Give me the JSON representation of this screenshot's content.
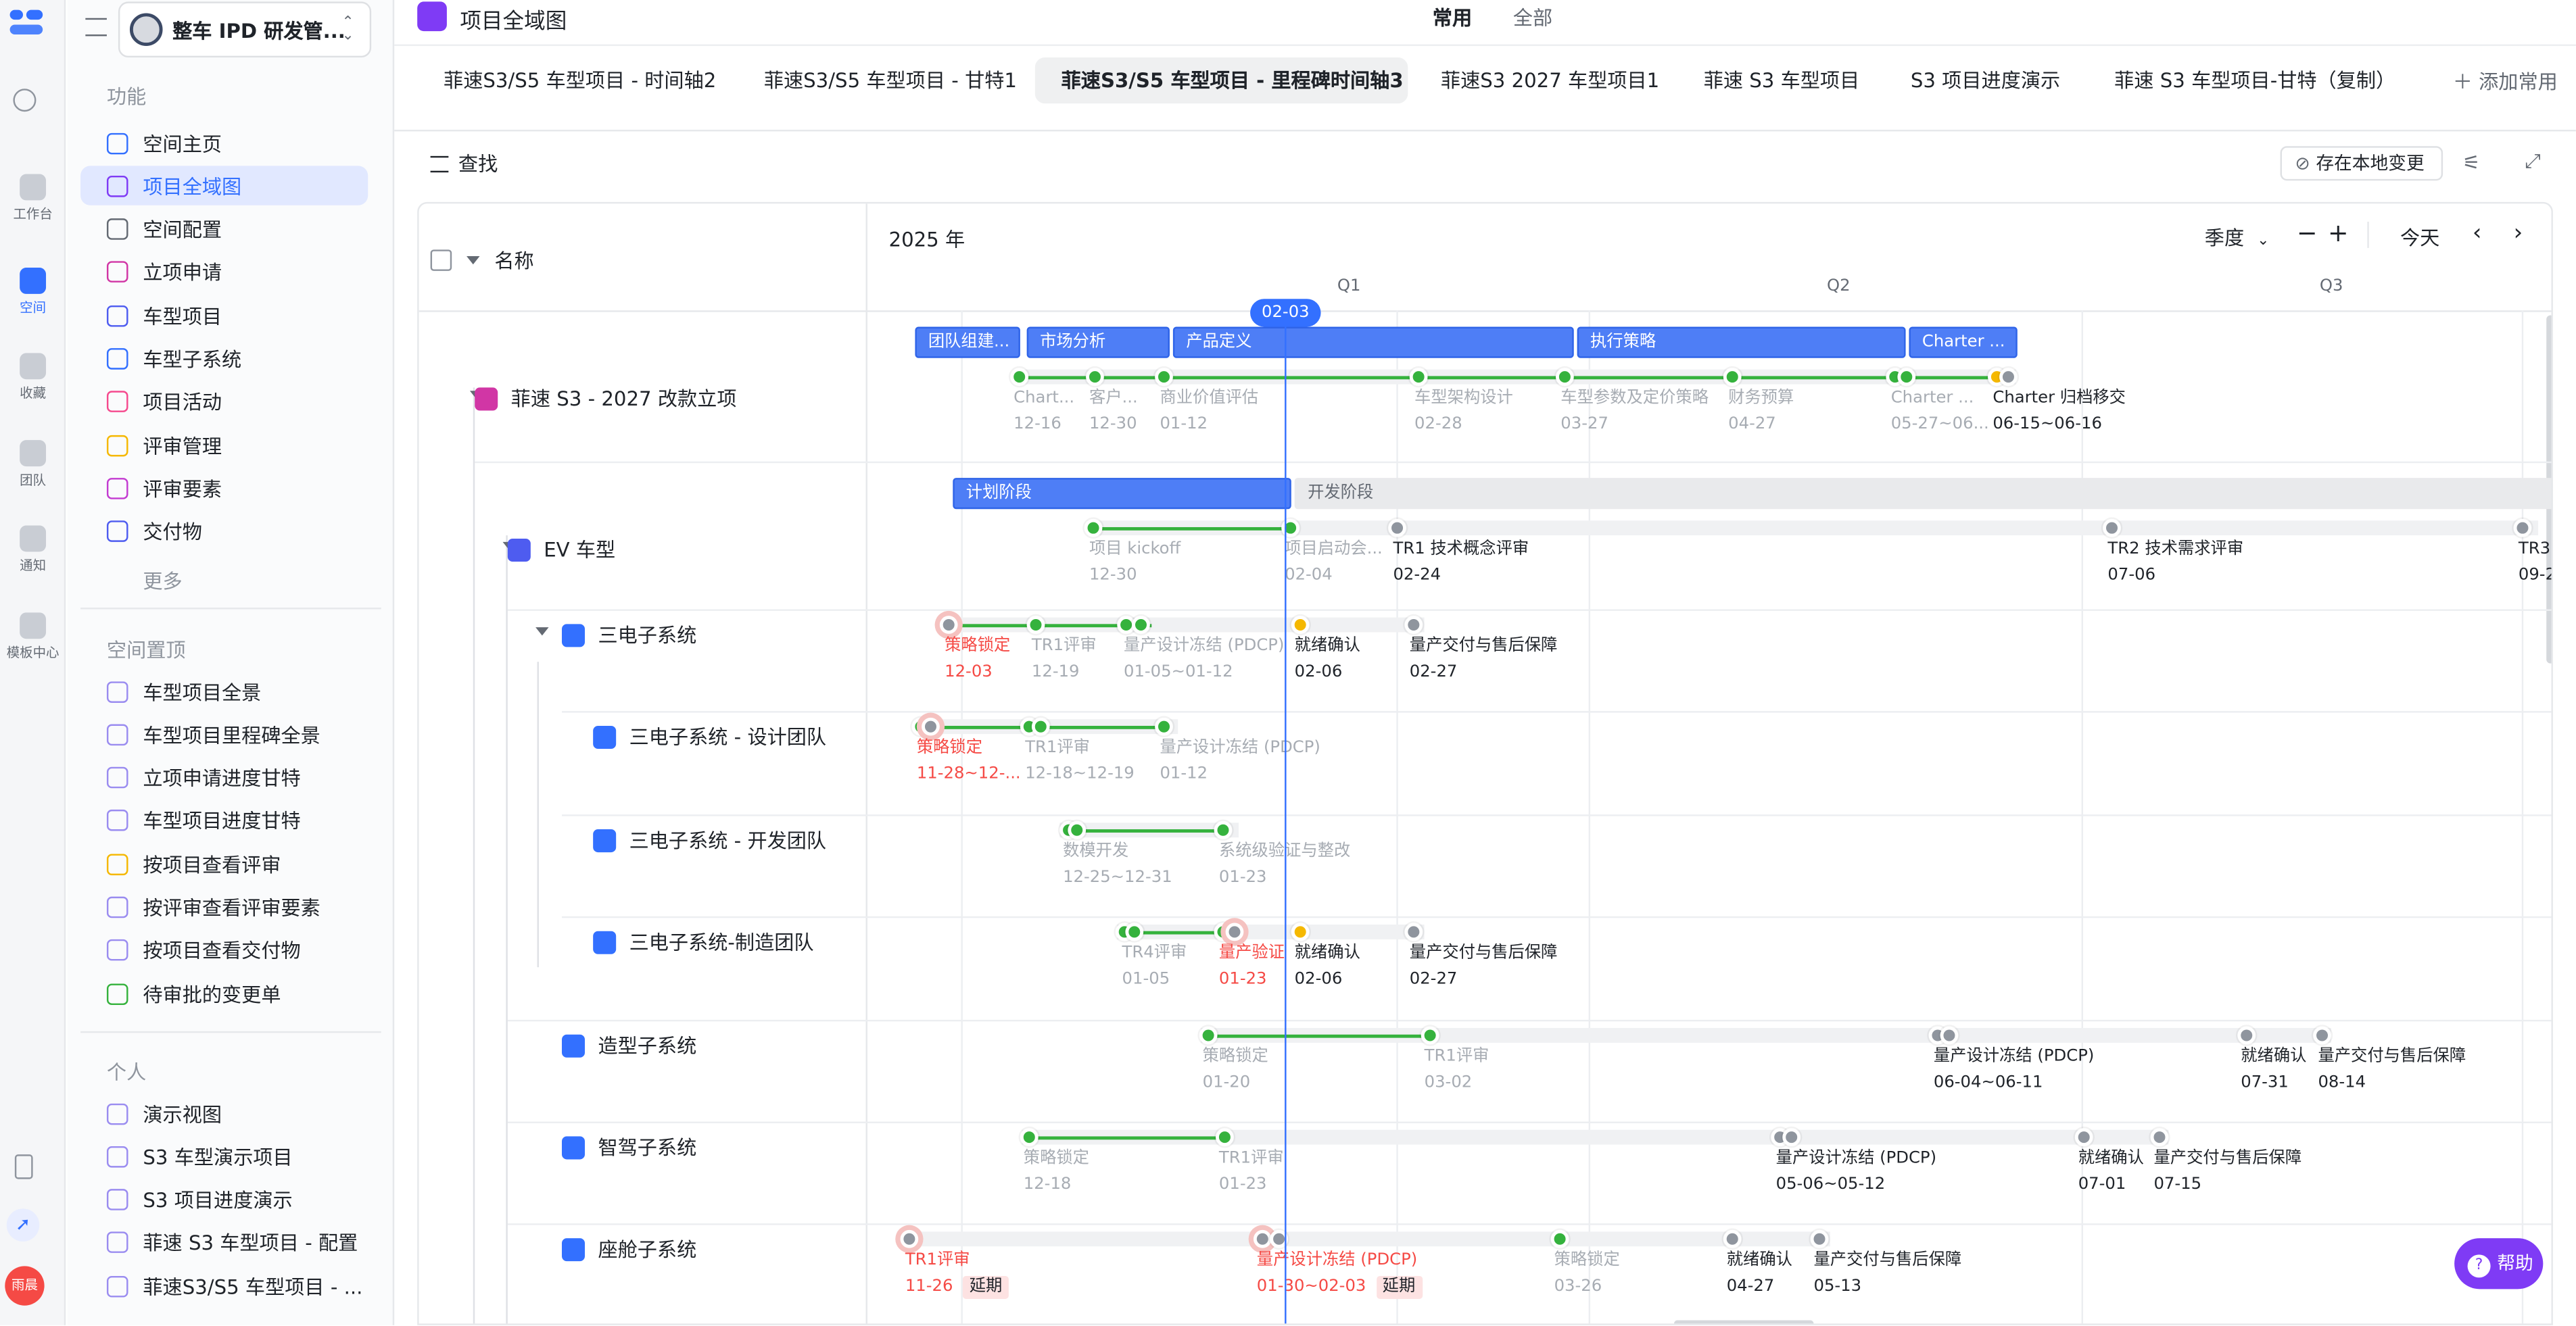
{
  "app": {
    "workspace_name": "整车 IPD 研发管...",
    "page_title": "项目全域图"
  },
  "header": {
    "filter_common": "常用",
    "filter_all": "全部"
  },
  "rail": [
    {
      "label": "工作台",
      "icon": "home-icon"
    },
    {
      "label": "空间",
      "icon": "space-icon",
      "active": true
    },
    {
      "label": "收藏",
      "icon": "star-icon"
    },
    {
      "label": "团队",
      "icon": "team-icon"
    },
    {
      "label": "通知",
      "icon": "bell-icon"
    },
    {
      "label": "模板中心",
      "icon": "template-icon"
    }
  ],
  "user": {
    "avatar_text": "雨晨"
  },
  "sidebar": {
    "section_function": "功能",
    "function_items": [
      "空间主页",
      "项目全域图",
      "空间配置",
      "立项申请",
      "车型项目",
      "车型子系统",
      "项目活动",
      "评审管理",
      "评审要素",
      "交付物"
    ],
    "more": "更多",
    "section_pinned": "空间置顶",
    "pinned_items": [
      "车型项目全景",
      "车型项目里程碑全景",
      "立项申请进度甘特",
      "车型项目进度甘特",
      "按项目查看评审",
      "按评审查看评审要素",
      "按项目查看交付物",
      "待审批的变更单"
    ],
    "section_personal": "个人",
    "personal_items": [
      "演示视图",
      "S3 车型演示项目",
      "S3 项目进度演示",
      "菲速 S3 车型项目 - 配置",
      "菲速S3/S5 车型项目 - ..."
    ]
  },
  "tabs": [
    "菲速S3/S5 车型项目 - 时间轴2",
    "菲速S3/S5 车型项目 - 甘特1",
    "菲速S3/S5 车型项目 - 里程碑时间轴3",
    "菲速S3 2027 车型项目1",
    "菲速 S3 车型项目",
    "S3 项目进度演示",
    "菲速 S3 车型项目-甘特（复制）"
  ],
  "add_common": "添加常用",
  "toolbar": {
    "search": "查找",
    "save_local": "存在本地变更"
  },
  "gantt": {
    "name_header": "名称",
    "year": "2025 年",
    "scale": "季度",
    "today": "今天",
    "quarters": [
      "Q1",
      "Q2",
      "Q3"
    ],
    "today_marker": "02-03",
    "rows": [
      {
        "name": "菲速 S3 - 2027 改款立项",
        "phases": [
          "团队组建...",
          "市场分析",
          "产品定义",
          "执行策略",
          "Charter ..."
        ],
        "milestones": [
          {
            "label": "Chart...",
            "date": "12-16"
          },
          {
            "label": "客户...",
            "date": "12-30"
          },
          {
            "label": "商业价值评估",
            "date": "01-12"
          },
          {
            "label": "车型架构设计",
            "date": "02-28"
          },
          {
            "label": "车型参数及定价策略",
            "date": "03-27"
          },
          {
            "label": "财务预算",
            "date": "04-27"
          },
          {
            "label": "Charter ...",
            "date": "05-27~06..."
          },
          {
            "label": "Charter 归档移交",
            "date": "06-15~06-16"
          }
        ]
      },
      {
        "name": "EV 车型",
        "phases": [
          "计划阶段",
          "开发阶段"
        ],
        "milestones": [
          {
            "label": "项目 kickoff",
            "date": "12-30"
          },
          {
            "label": "项目启动会...",
            "date": "02-04"
          },
          {
            "label": "TR1 技术概念评审",
            "date": "02-24"
          },
          {
            "label": "TR2 技术需求评审",
            "date": "07-06"
          },
          {
            "label": "TR3",
            "date": "09-2"
          }
        ]
      },
      {
        "name": "三电子系统",
        "milestones": [
          {
            "label": "策略锁定",
            "date": "12-03"
          },
          {
            "label": "TR1评审",
            "date": "12-19"
          },
          {
            "label": "量产设计冻结 (PDCP)",
            "date": "01-05~01-12"
          },
          {
            "label": "就绪确认",
            "date": "02-06"
          },
          {
            "label": "量产交付与售后保障",
            "date": "02-27"
          }
        ]
      },
      {
        "name": "三电子系统 - 设计团队",
        "milestones": [
          {
            "label": "策略锁定",
            "date": "11-28~12-..."
          },
          {
            "label": "TR1评审",
            "date": "12-18~12-19"
          },
          {
            "label": "量产设计冻结 (PDCP)",
            "date": "01-12"
          }
        ]
      },
      {
        "name": "三电子系统 - 开发团队",
        "milestones": [
          {
            "label": "数模开发",
            "date": "12-25~12-31"
          },
          {
            "label": "系统级验证与整改",
            "date": "01-23"
          }
        ]
      },
      {
        "name": "三电子系统-制造团队",
        "milestones": [
          {
            "label": "TR4评审",
            "date": "01-05"
          },
          {
            "label": "量产验证",
            "date": "01-23"
          },
          {
            "label": "就绪确认",
            "date": "02-06"
          },
          {
            "label": "量产交付与售后保障",
            "date": "02-27"
          }
        ]
      },
      {
        "name": "造型子系统",
        "milestones": [
          {
            "label": "策略锁定",
            "date": "01-20"
          },
          {
            "label": "TR1评审",
            "date": "03-02"
          },
          {
            "label": "量产设计冻结 (PDCP)",
            "date": "06-04~06-11"
          },
          {
            "label": "就绪确认",
            "date": "07-31"
          },
          {
            "label": "量产交付与售后保障",
            "date": "08-14"
          }
        ]
      },
      {
        "name": "智驾子系统",
        "milestones": [
          {
            "label": "策略锁定",
            "date": "12-18"
          },
          {
            "label": "TR1评审",
            "date": "01-23"
          },
          {
            "label": "量产设计冻结 (PDCP)",
            "date": "05-06~05-12"
          },
          {
            "label": "就绪确认",
            "date": "07-01"
          },
          {
            "label": "量产交付与售后保障",
            "date": "07-15"
          }
        ]
      },
      {
        "name": "座舱子系统",
        "milestones": [
          {
            "label": "TR1评审",
            "date": "11-26",
            "tag": "延期"
          },
          {
            "label": "量产设计冻结 (PDCP)",
            "date": "01-30~02-03",
            "tag": "延期"
          },
          {
            "label": "策略锁定",
            "date": "03-26"
          },
          {
            "label": "就绪确认",
            "date": "04-27"
          },
          {
            "label": "量产交付与售后保障",
            "date": "05-13"
          }
        ]
      }
    ]
  },
  "help": "帮助"
}
